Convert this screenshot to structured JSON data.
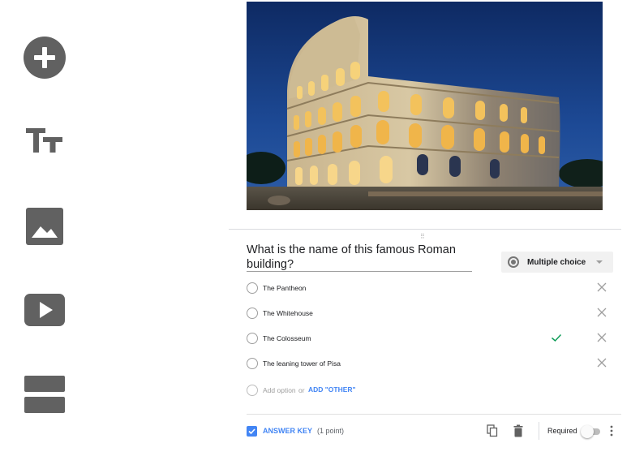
{
  "toolbar": {
    "items": [
      {
        "icon": "add-circle-icon"
      },
      {
        "icon": "title-text-icon"
      },
      {
        "icon": "image-icon"
      },
      {
        "icon": "video-icon"
      },
      {
        "icon": "section-icon"
      }
    ],
    "icon_color": "#616161"
  },
  "question": {
    "text": "What is the name of this famous Roman building?",
    "type": {
      "label": "Multiple choice",
      "icon": "radio-button-icon"
    },
    "options": [
      {
        "label": "The Pantheon",
        "correct": false
      },
      {
        "label": "The Whitehouse",
        "correct": false
      },
      {
        "label": "The Colosseum",
        "correct": true
      },
      {
        "label": "The leaning tower of Pisa",
        "correct": false
      }
    ],
    "add_option_label": "Add option",
    "or_label": "or",
    "add_other_label": "ADD \"OTHER\""
  },
  "footer": {
    "answer_key_label": "ANSWER KEY",
    "points_label": "(1 point)",
    "required_label": "Required",
    "required_on": false
  },
  "colors": {
    "accent": "#4285f4",
    "correct_check": "#0f9d58"
  }
}
